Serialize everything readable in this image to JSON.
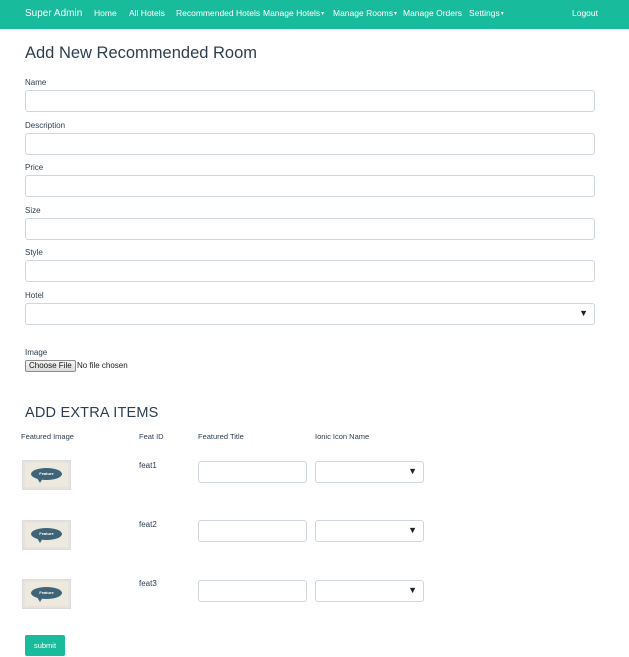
{
  "colors": {
    "accent": "#18bc9c",
    "text": "#2c3e50",
    "thumbnail_bubble": "#3f6478"
  },
  "navbar": {
    "brand": "Super Admin",
    "items": [
      {
        "label": "Home"
      },
      {
        "label": "All Hotels"
      },
      {
        "label": "Recommended Hotels"
      },
      {
        "label": "Manage Hotels",
        "dropdown": true
      },
      {
        "label": "Manage Rooms",
        "dropdown": true
      },
      {
        "label": "Manage Orders"
      },
      {
        "label": "Settings",
        "dropdown": true
      }
    ],
    "logout": "Logout",
    "dropdown_caret": "▾"
  },
  "form": {
    "title": "Add New Recommended Room",
    "fields": [
      {
        "label": "Name",
        "value": ""
      },
      {
        "label": "Description",
        "value": ""
      },
      {
        "label": "Price",
        "value": ""
      },
      {
        "label": "Size",
        "value": ""
      },
      {
        "label": "Style",
        "value": ""
      }
    ],
    "hotel": {
      "label": "Hotel",
      "selected": ""
    },
    "image": {
      "label": "Image",
      "button": "Choose File",
      "status": "No file chosen"
    }
  },
  "extra_items": {
    "title": "ADD EXTRA ITEMS",
    "columns": [
      "Featured Image",
      "Feat ID",
      "Featured Title",
      "Ionic Icon Name"
    ],
    "rows": [
      {
        "id": "feat1",
        "thumbnail_text": "Feature",
        "title": "",
        "icon": ""
      },
      {
        "id": "feat2",
        "thumbnail_text": "Feature",
        "title": "",
        "icon": ""
      },
      {
        "id": "feat3",
        "thumbnail_text": "Feature",
        "title": "",
        "icon": ""
      }
    ],
    "select_arrow": "▼"
  },
  "submit_label": "submit"
}
